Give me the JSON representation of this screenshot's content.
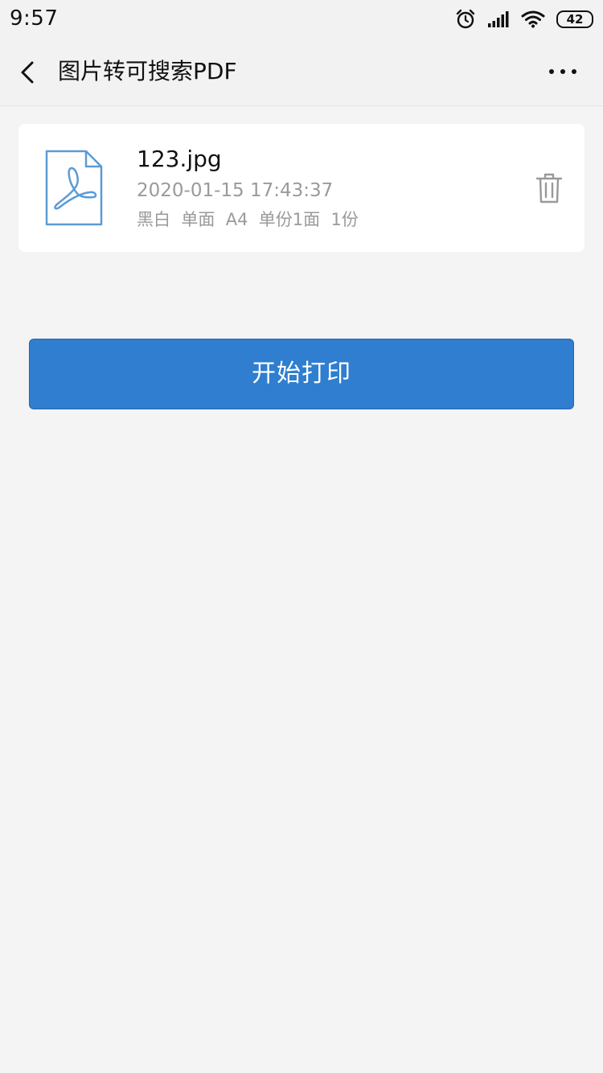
{
  "status_bar": {
    "time": "9:57",
    "battery": "42",
    "icons": [
      "alarm-icon",
      "signal-icon",
      "wifi-icon",
      "battery-icon"
    ]
  },
  "header": {
    "title": "图片转可搜索PDF",
    "back_icon": "chevron-left-icon",
    "more_icon": "more-horizontal-icon"
  },
  "file": {
    "name": "123.jpg",
    "date": "2020-01-15 17:43:37",
    "settings": "黑白  单面  A4  单份1面  1份",
    "icon": "pdf-file-icon",
    "delete_icon": "trash-icon"
  },
  "print_button": {
    "label": "开始打印"
  },
  "colors": {
    "accent": "#2f7ecf",
    "background": "#f4f4f4",
    "card": "#ffffff",
    "secondary_text": "#9a9a9a",
    "file_icon": "#5b9bd5"
  }
}
